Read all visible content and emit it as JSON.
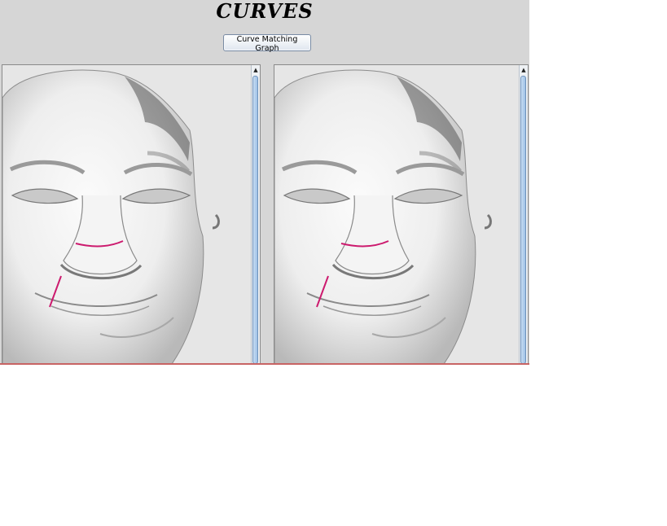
{
  "window": {
    "title": "CURVES"
  },
  "toolbar": {
    "match_button_label": "Curve Matching Graph"
  },
  "panels": [
    {
      "name": "left-face-view",
      "scroll_up_glyph": "▲"
    },
    {
      "name": "right-face-view",
      "scroll_up_glyph": "▲"
    }
  ],
  "colors": {
    "curve": "#cc1a6e",
    "background": "#d6d6d6",
    "divider": "#c86464"
  },
  "icons": {
    "scroll_arrow": "scroll-up-arrow-icon"
  }
}
